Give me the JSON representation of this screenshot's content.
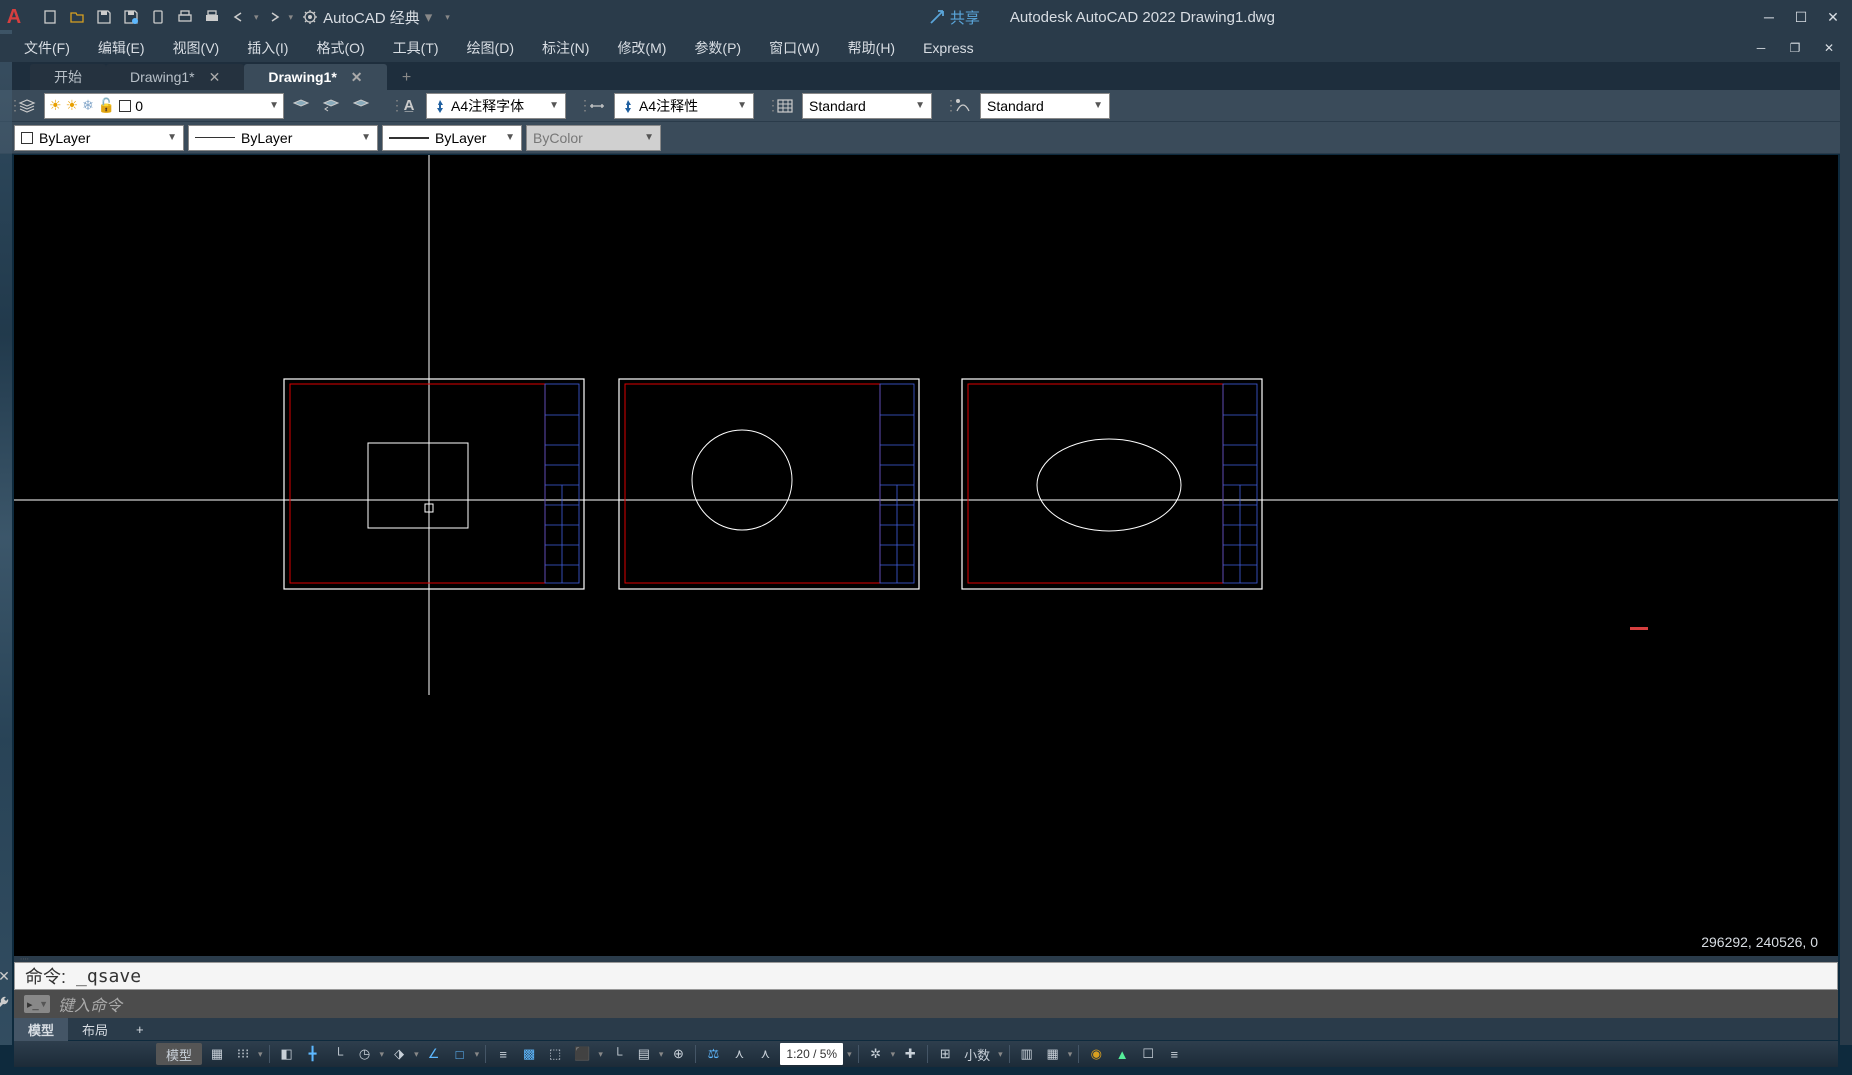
{
  "titlebar": {
    "logo": "A",
    "workspace": "AutoCAD 经典",
    "share": "共享",
    "title": "Autodesk AutoCAD 2022    Drawing1.dwg"
  },
  "menu": {
    "items": [
      "文件(F)",
      "编辑(E)",
      "视图(V)",
      "插入(I)",
      "格式(O)",
      "工具(T)",
      "绘图(D)",
      "标注(N)",
      "修改(M)",
      "参数(P)",
      "窗口(W)",
      "帮助(H)",
      "Express"
    ]
  },
  "tabs": {
    "items": [
      {
        "label": "开始",
        "closable": false
      },
      {
        "label": "Drawing1*",
        "closable": true
      },
      {
        "label": "Drawing1*",
        "closable": true,
        "active": true
      }
    ]
  },
  "layer": {
    "current": "0",
    "textstyle_label": "A4注释字体",
    "dimstyle_label": "A4注释性",
    "tablestyle": "Standard",
    "mlstyle": "Standard"
  },
  "props": {
    "color": "ByLayer",
    "linetype": "ByLayer",
    "lineweight": "ByLayer",
    "plotstyle": "ByColor"
  },
  "cmd": {
    "history_prefix": "命令:",
    "history_cmd": "_qsave",
    "placeholder": "键入命令"
  },
  "layout": {
    "tabs": [
      "模型",
      "布局"
    ]
  },
  "status": {
    "coords": "296292, 240526, 0",
    "model": "模型",
    "scale": "1:20 / 5%",
    "units": "小数"
  }
}
